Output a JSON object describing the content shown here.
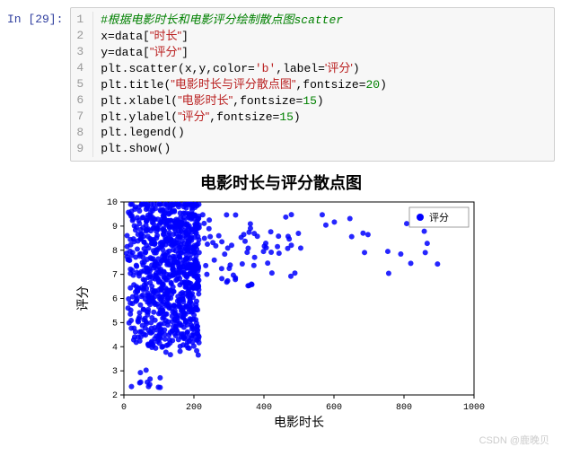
{
  "prompt": "In [29]:",
  "code": {
    "lines": [
      {
        "n": "1",
        "seg": [
          {
            "t": "#根据电影时长和电影评分绘制散点图",
            "cls": "c-cn"
          },
          {
            "t": "scatter",
            "cls": "c-comment"
          }
        ]
      },
      {
        "n": "2",
        "seg": [
          {
            "t": "x=data[",
            "cls": "c-kw"
          },
          {
            "t": "\"时长\"",
            "cls": "c-strcn"
          },
          {
            "t": "]",
            "cls": "c-kw"
          }
        ]
      },
      {
        "n": "3",
        "seg": [
          {
            "t": "y=data[",
            "cls": "c-kw"
          },
          {
            "t": "\"评分\"",
            "cls": "c-strcn"
          },
          {
            "t": "]",
            "cls": "c-kw"
          }
        ]
      },
      {
        "n": "4",
        "seg": [
          {
            "t": "plt.scatter(x,y,color=",
            "cls": "c-kw"
          },
          {
            "t": "'b'",
            "cls": "c-str"
          },
          {
            "t": ",label=",
            "cls": "c-kw"
          },
          {
            "t": "'评分'",
            "cls": "c-strcn"
          },
          {
            "t": ")",
            "cls": "c-kw"
          }
        ]
      },
      {
        "n": "5",
        "seg": [
          {
            "t": "plt.title(",
            "cls": "c-kw"
          },
          {
            "t": "\"电影时长与评分散点图\"",
            "cls": "c-strcn"
          },
          {
            "t": ",fontsize=",
            "cls": "c-kw"
          },
          {
            "t": "20",
            "cls": "c-num"
          },
          {
            "t": ")",
            "cls": "c-kw"
          }
        ]
      },
      {
        "n": "6",
        "seg": [
          {
            "t": "plt.xlabel(",
            "cls": "c-kw"
          },
          {
            "t": "\"电影时长\"",
            "cls": "c-strcn"
          },
          {
            "t": ",fontsize=",
            "cls": "c-kw"
          },
          {
            "t": "15",
            "cls": "c-num"
          },
          {
            "t": ")",
            "cls": "c-kw"
          }
        ]
      },
      {
        "n": "7",
        "seg": [
          {
            "t": "plt.ylabel(",
            "cls": "c-kw"
          },
          {
            "t": "\"评分\"",
            "cls": "c-strcn"
          },
          {
            "t": ",fontsize=",
            "cls": "c-kw"
          },
          {
            "t": "15",
            "cls": "c-num"
          },
          {
            "t": ")",
            "cls": "c-kw"
          }
        ]
      },
      {
        "n": "8",
        "seg": [
          {
            "t": "plt.legend()",
            "cls": "c-kw"
          }
        ]
      },
      {
        "n": "9",
        "seg": [
          {
            "t": "plt.show()",
            "cls": "c-kw"
          }
        ]
      }
    ]
  },
  "chart_data": {
    "type": "scatter",
    "title": "电影时长与评分散点图",
    "xlabel": "电影时长",
    "ylabel": "评分",
    "xlim": [
      0,
      1000
    ],
    "ylim": [
      2,
      10
    ],
    "xticks": [
      0,
      200,
      400,
      600,
      800,
      1000
    ],
    "yticks": [
      2,
      3,
      4,
      5,
      6,
      7,
      8,
      9,
      10
    ],
    "legend": {
      "label": "评分",
      "position": "upper right"
    },
    "color": "#0000ff",
    "note": "Very dense cluster for 时长 0–200 with 评分 mostly 4–10; scattered points 200–1000 mostly 评分 7–9; few low outliers near 评分 2–3 at short durations."
  },
  "watermark": "CSDN @鹿晚贝"
}
